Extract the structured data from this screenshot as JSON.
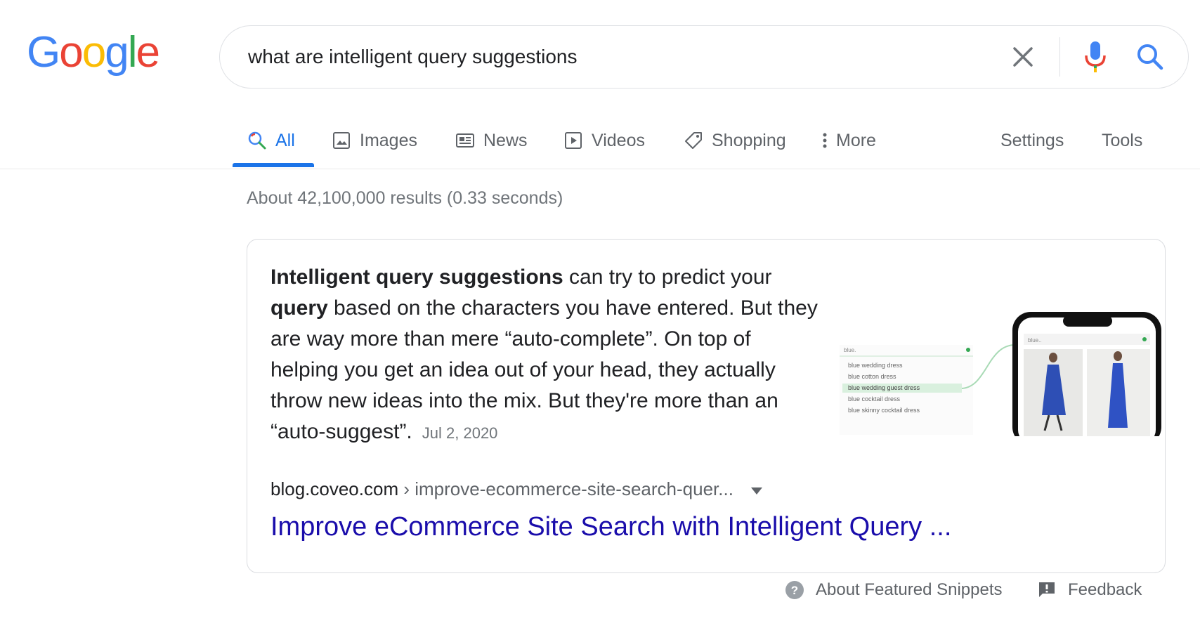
{
  "logo": {
    "letters": [
      "G",
      "o",
      "o",
      "g",
      "l",
      "e"
    ],
    "colors": [
      "#4285f4",
      "#ea4335",
      "#fbbc05",
      "#4285f4",
      "#34a853",
      "#ea4335"
    ]
  },
  "search": {
    "query": "what are intelligent query suggestions"
  },
  "tabs": [
    {
      "label": "All",
      "icon": "search-icon",
      "active": true
    },
    {
      "label": "Images",
      "icon": "image-icon"
    },
    {
      "label": "News",
      "icon": "newspaper-icon"
    },
    {
      "label": "Videos",
      "icon": "play-icon"
    },
    {
      "label": "Shopping",
      "icon": "tag-icon"
    },
    {
      "label": "More",
      "icon": "more-vert-icon"
    }
  ],
  "tools": {
    "settings": "Settings",
    "tools": "Tools"
  },
  "stats": "About 42,100,000 results (0.33 seconds)",
  "featured": {
    "text_bold_1": "Intelligent query suggestions",
    "text_1": " can try to predict your ",
    "text_bold_2": "query",
    "text_2": " based on the characters you have entered. But they are way more than mere “auto-complete”. On top of helping you get an idea out of your head, they actually throw new ideas into the mix. But they're more than an “auto-suggest”.",
    "date": "Jul 2, 2020",
    "thumbnail": {
      "typed": "blue.",
      "suggestions": [
        "blue wedding dress",
        "blue cotton dress",
        "blue wedding guest dress",
        "blue cocktail dress",
        "blue skinny cocktail dress"
      ],
      "phone_query": "blue.."
    },
    "source_domain": "blog.coveo.com",
    "source_path": "› improve-ecommerce-site-search-quer...",
    "title": "Improve eCommerce Site Search with Intelligent Query ..."
  },
  "footer": {
    "about": "About Featured Snippets",
    "feedback": "Feedback"
  },
  "colors": {
    "accent": "#1a73e8",
    "link": "#1a0dab"
  }
}
